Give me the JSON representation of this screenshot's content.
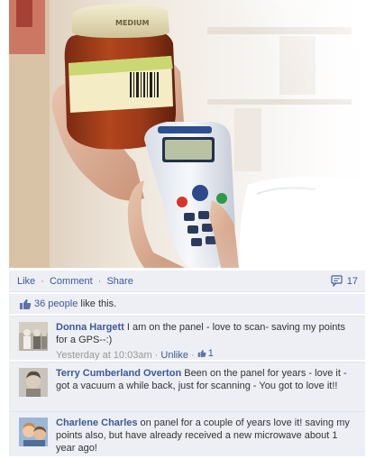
{
  "post": {
    "photo_icon": "barcode-scanner-photo"
  },
  "actions": {
    "like_label": "Like",
    "comment_label": "Comment",
    "share_label": "Share",
    "separator": "·",
    "comment_count": "17",
    "comment_icon": "comment-bubble-icon"
  },
  "likes": {
    "icon": "thumbs-up-icon",
    "people_link": "36 people",
    "suffix": " like this."
  },
  "comments": [
    {
      "author": "Donna Hargett",
      "text": " I am on the panel - love to scan- saving my points for a GPS--:)",
      "timestamp": "Yesterday at 10:03am",
      "separator": " · ",
      "unlike_label": "Unlike",
      "like_count": "1"
    },
    {
      "author": "Terry Cumberland Overton",
      "text": " Been on the panel for years - love it - got a vacuum a while back, just for scanning - You got to love it!!"
    },
    {
      "author": "Charlene Charles",
      "text": " on panel for a couple of years love it! saving my points also, but have already received a new microwave about 1 year ago!"
    }
  ],
  "colors": {
    "link_blue": "#3b5998",
    "panel_bg": "#edeff4",
    "meta_gray": "#999999"
  }
}
